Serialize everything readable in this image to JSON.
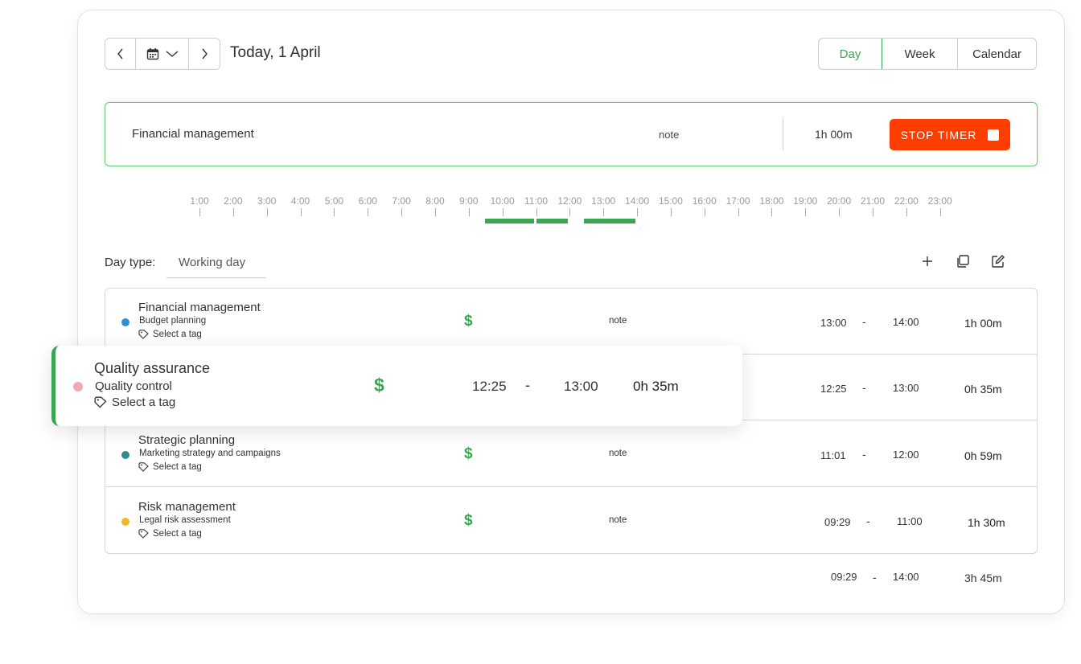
{
  "header": {
    "date_title": "Today, 1 April",
    "view_tabs": [
      "Day",
      "Week",
      "Calendar"
    ],
    "active_view": "Day"
  },
  "timer": {
    "task": "Financial management",
    "note": "note",
    "duration": "1h 00m",
    "stop_label": "STOP TIMER"
  },
  "timeline": {
    "hours": [
      "1:00",
      "2:00",
      "3:00",
      "4:00",
      "5:00",
      "6:00",
      "7:00",
      "8:00",
      "9:00",
      "10:00",
      "11:00",
      "12:00",
      "13:00",
      "14:00",
      "15:00",
      "16:00",
      "17:00",
      "18:00",
      "19:00",
      "20:00",
      "21:00",
      "22:00",
      "23:00"
    ],
    "tracked_segments": [
      {
        "start": "09:29",
        "end": "11:00"
      },
      {
        "start": "11:01",
        "end": "12:00"
      },
      {
        "start": "12:25",
        "end": "14:00"
      }
    ]
  },
  "day_type": {
    "label": "Day type:",
    "value": "Working day"
  },
  "entries": [
    {
      "task": "Financial management",
      "project": "Budget planning",
      "project_color": "#2d8fd6",
      "tag": "Select a tag",
      "note": "note",
      "start": "13:00",
      "end": "14:00",
      "duration": "1h 00m"
    },
    {
      "task": "Quality assurance",
      "project": "Quality control",
      "project_color": "#f1a9b0",
      "tag": "Select a tag",
      "note": "",
      "start": "12:25",
      "end": "13:00",
      "duration": "0h 35m"
    },
    {
      "task": "Strategic planning",
      "project": "Marketing strategy and campaigns",
      "project_color": "#2f8a93",
      "tag": "Select a tag",
      "note": "note",
      "start": "11:01",
      "end": "12:00",
      "duration": "0h 59m"
    },
    {
      "task": "Risk management",
      "project": "Legal risk assessment",
      "project_color": "#f2b824",
      "tag": "Select a tag",
      "note": "note",
      "start": "09:29",
      "end": "11:00",
      "duration": "1h 30m"
    }
  ],
  "floating_entry": {
    "task": "Quality assurance",
    "project": "Quality control",
    "tag": "Select a tag",
    "billable_symbol": "$",
    "start": "12:25",
    "dash": "-",
    "end": "13:00",
    "duration": "0h 35m"
  },
  "totals": {
    "start": "09:29",
    "dash": "-",
    "end": "14:00",
    "duration": "3h 45m"
  },
  "symbols": {
    "billable": "$",
    "dash": "-"
  },
  "icons": [
    "chevron-left-icon",
    "calendar-icon",
    "chevron-down-icon",
    "chevron-right-icon",
    "plus-icon",
    "copy-icon",
    "edit-icon",
    "tag-icon",
    "dollar-icon"
  ],
  "colors": {
    "accent": "#3aa654",
    "stop": "#ff3d00"
  }
}
